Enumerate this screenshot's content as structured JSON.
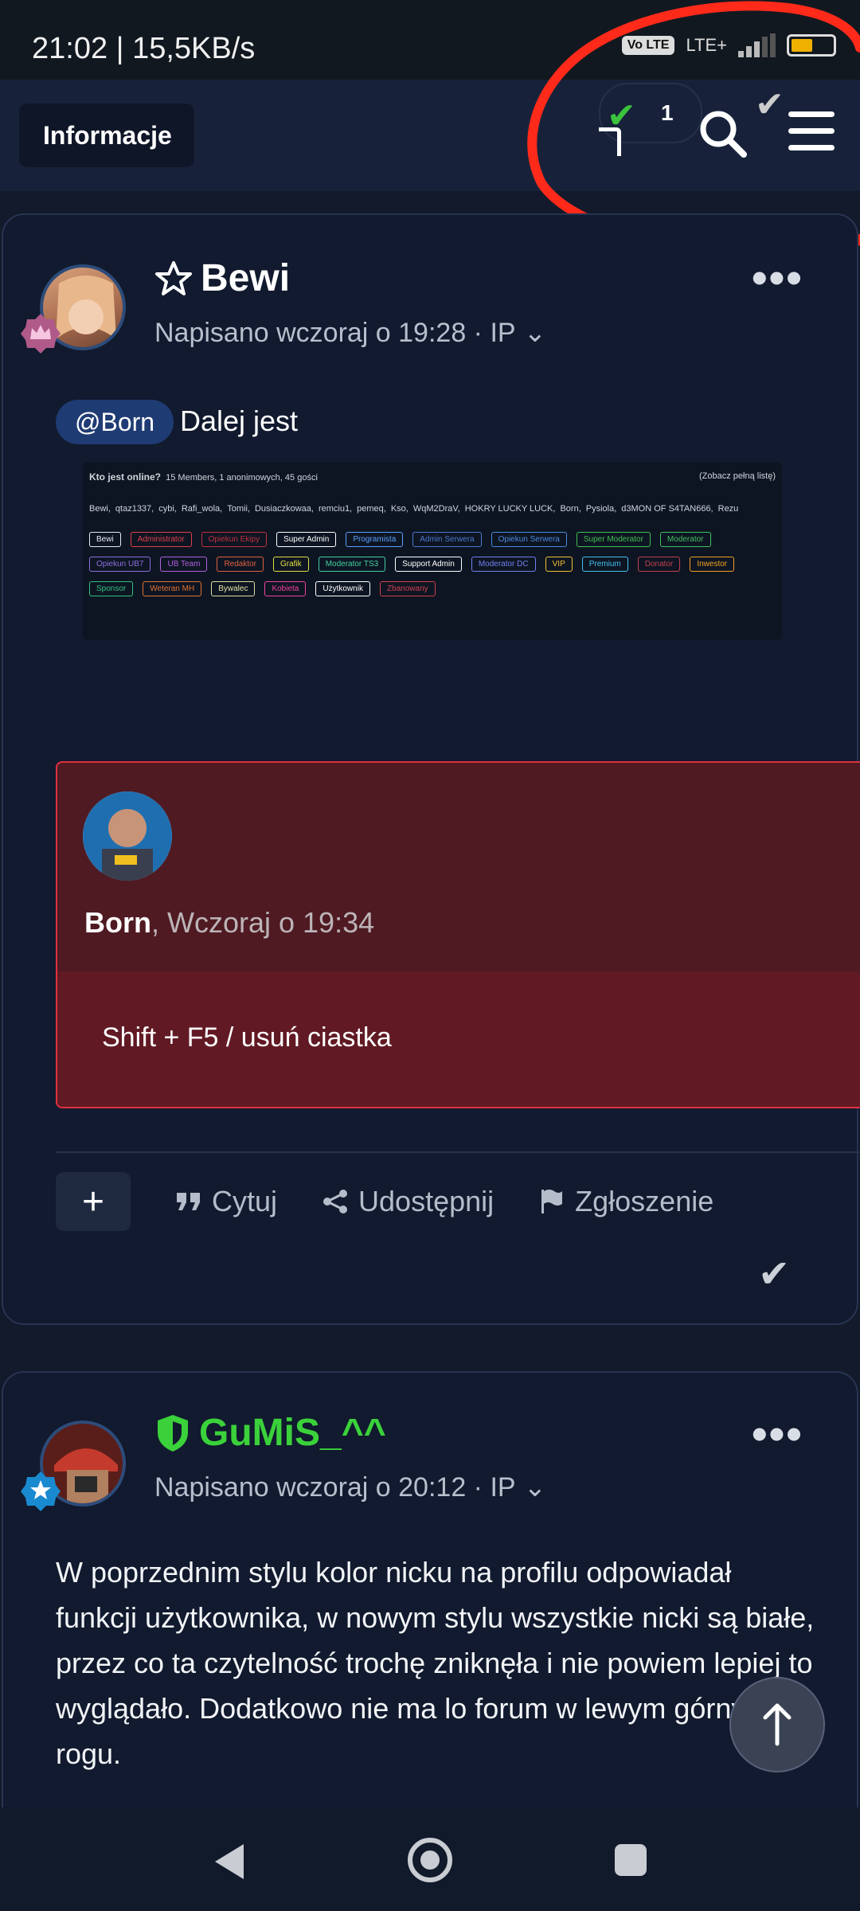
{
  "status_bar": {
    "time_speed": "21:02 | 15,5KB/s",
    "volte": "Vo LTE",
    "network": "LTE+"
  },
  "top_bar": {
    "breadcrumb_label": "Informacje",
    "notification_count": "1"
  },
  "post1": {
    "author": "Bewi",
    "meta": "Napisano wczoraj o 19:28 · IP",
    "mention": "@Born",
    "text": "Dalej jest",
    "embedded_image": {
      "title": "Kto jest online?",
      "subtitle": "15 Members, 1 anonimowych, 45 gości",
      "link": "(Zobacz pełną listę)",
      "names": [
        "Bewi,",
        "qtaz1337,",
        "cybi,",
        "Rafi_wola,",
        "Tomii,",
        "Dusiaczkowaa,",
        "remciu1,",
        "pemeq,",
        "Kso,",
        "WqM2DraV,",
        "HOKRY LUCKY LUCK,",
        "Born,",
        "Pysiola,",
        "d3MON OF S4TAN666,",
        "Rezu"
      ],
      "tags": [
        {
          "label": "Bewi",
          "color": "#e6e9f0"
        },
        {
          "label": "Administrator",
          "color": "#e0404a"
        },
        {
          "label": "Opiekun Ekipy",
          "color": "#c03040"
        },
        {
          "label": "Super Admin",
          "color": "#ffffff"
        },
        {
          "label": "Programista",
          "color": "#5aa0ff"
        },
        {
          "label": "Admin Serwera",
          "color": "#4a7ad0"
        },
        {
          "label": "Opiekun Serwera",
          "color": "#4a8ae0"
        },
        {
          "label": "Super Moderator",
          "color": "#40c050"
        },
        {
          "label": "Moderator",
          "color": "#40c060"
        },
        {
          "label": "Opiekun UB7",
          "color": "#8a70e0"
        },
        {
          "label": "UB Team",
          "color": "#b060e0"
        },
        {
          "label": "Redaktor",
          "color": "#e06040"
        },
        {
          "label": "Grafik",
          "color": "#e0e040"
        },
        {
          "label": "Moderator TS3",
          "color": "#40d0a0"
        },
        {
          "label": "Support Admin",
          "color": "#ffffff"
        },
        {
          "label": "Moderator DC",
          "color": "#7080f0"
        },
        {
          "label": "VIP",
          "color": "#f0c030"
        },
        {
          "label": "Premium",
          "color": "#40c0f0"
        },
        {
          "label": "Donator",
          "color": "#c04050"
        },
        {
          "label": "Inwestor",
          "color": "#f0a020"
        },
        {
          "label": "Sponsor",
          "color": "#30c080"
        },
        {
          "label": "Weteran MH",
          "color": "#e07030"
        },
        {
          "label": "Bywalec",
          "color": "#e0e0a0"
        },
        {
          "label": "Kobieta",
          "color": "#f040a0"
        },
        {
          "label": "Użytkownik",
          "color": "#ffffff"
        },
        {
          "label": "Zbanowany",
          "color": "#d04050"
        }
      ]
    },
    "quote": {
      "author": "Born",
      "time": ", Wczoraj o 19:34",
      "text": "Shift + F5 / usuń ciastka"
    },
    "actions": {
      "quote": "Cytuj",
      "share": "Udostępnij",
      "report": "Zgłoszenie"
    }
  },
  "post2": {
    "author": "GuMiS_^^",
    "meta": "Napisano wczoraj o 20:12 · IP",
    "text": "W poprzednim stylu kolor nicku na profilu odpowiadał funkcji użytkownika, w nowym stylu wszystkie nicki są białe, przez co ta czytelność trochę zniknęła i nie powiem lepiej to wyglądało. Dodatkowo nie ma lo forum w lewym górnym rogu."
  },
  "colors": {
    "background": "#121a2b",
    "card": "#111a2e",
    "quote_bg": "#4f1a22",
    "quote_border": "#e03040",
    "mention_bg": "#1f3b73",
    "author2": "#3bd13b",
    "annotation": "#ff2a1a"
  }
}
